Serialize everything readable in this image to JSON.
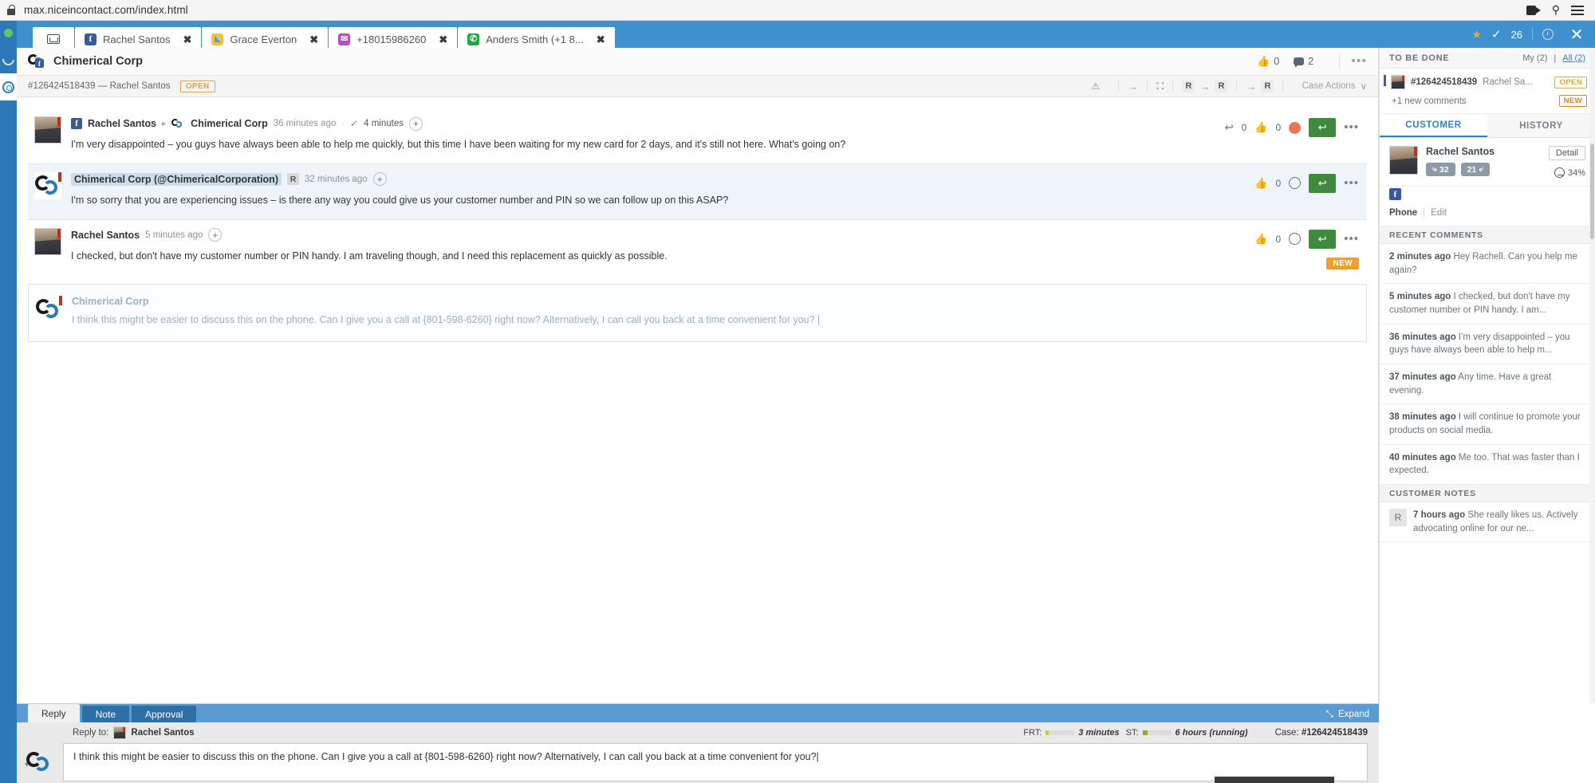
{
  "browser": {
    "url": "max.niceincontact.com/index.html",
    "lock_icon": "lock-icon",
    "camera_icon": "camera-icon",
    "pin_icon": "pin-icon",
    "menu_icon": "menu-icon"
  },
  "tabstrip": {
    "inbox_tab_label": "",
    "tabs": [
      {
        "label": "Rachel Santos",
        "channel": "facebook",
        "glyph": "f",
        "close": "✖"
      },
      {
        "label": "Grace Everton",
        "channel": "twitter",
        "glyph": "",
        "close": "✖"
      },
      {
        "label": "+18015986260",
        "channel": "sms",
        "glyph": "✉",
        "close": "✖"
      },
      {
        "label": "Anders Smith (+1 8...",
        "channel": "whatsapp",
        "glyph": "✆",
        "close": "✖"
      }
    ],
    "star_icon": "★",
    "check_icon": "✓",
    "count": "26",
    "clock_icon": "clock-icon",
    "close_icon": "✕"
  },
  "rail": {
    "status_dot": "online-status-dot",
    "link_icon": "link-icon",
    "gear_icon": "gear-icon"
  },
  "case": {
    "brand_title": "Chimerical Corp",
    "likes": "0",
    "comments": "2",
    "more_icon": "•••",
    "case_id_line": "#126424518439 — Rachel Santos",
    "status": "OPEN",
    "warn_icon": "⚠",
    "arrow_icon": "→",
    "group_icon": "⛚",
    "r_label": "R",
    "case_actions_label": "Case Actions",
    "chevron_down": "∨"
  },
  "messages": [
    {
      "type": "customer",
      "sender": "Rachel Santos",
      "channel_glyph": "f",
      "destination": "Chimerical Corp",
      "time": "36 minutes ago",
      "resolve_tick": "✓",
      "resolve_time": "4 minutes",
      "plus": "+",
      "text": "I'm very disappointed – you guys have always been able to help me quickly, but this time I have been waiting for my new card for 2 days, and it's still not here. What's going on?",
      "reply_count": "0",
      "like_count": "0",
      "reply_icon": "↩",
      "thumb_icon": "👍",
      "smile_icon": "smile-icon",
      "reply_button_icon": "↩",
      "more_icon": "•••"
    },
    {
      "type": "agent",
      "sender": "Chimerical Corp (@ChimericalCorporation)",
      "rtag": "R",
      "time": "32 minutes ago",
      "plus": "+",
      "text": "I'm so sorry that you are experiencing issues – is there any way you could give  us your customer number and PIN so we can follow up on this ASAP?",
      "like_count": "0",
      "thumb_icon": "👍",
      "smile_icon": "smile-icon",
      "reply_button_icon": "↩",
      "more_icon": "•••"
    },
    {
      "type": "customer",
      "sender": "Rachel Santos",
      "time": "5 minutes ago",
      "plus": "+",
      "text": "I checked, but don't have my customer number or PIN handy. I am traveling though, and I need this replacement as quickly as possible.",
      "like_count": "0",
      "thumb_icon": "👍",
      "smile_icon": "smile-icon",
      "reply_button_icon": "↩",
      "more_icon": "•••",
      "new_badge": "NEW"
    }
  ],
  "draft": {
    "sender": "Chimerical Corp",
    "text": "I think this might be easier to discuss this on the phone. Can I give you a call at {801-598-6260} right now? Alternatively, I can call you back at a time convenient for you? |"
  },
  "right_panel": {
    "to_be_done_title": "TO BE DONE",
    "my_label": "My (2)",
    "all_label": "All (2)",
    "separator": "|",
    "item": {
      "id": "#126424518439",
      "name": "Rachel Sa...",
      "status": "OPEN",
      "sub": "+1 new comments",
      "sub_badge": "NEW"
    },
    "tabs": [
      {
        "label": "CUSTOMER",
        "active": true
      },
      {
        "label": "HISTORY",
        "active": false
      }
    ],
    "customer": {
      "name": "Rachel Santos",
      "detail_button": "Detail",
      "followers": "32",
      "following": "21",
      "sentiment": "34%",
      "facebook_glyph": "f",
      "phone_label": "Phone",
      "phone_value": "",
      "edit_label": "Edit",
      "divider": "|"
    },
    "recent_comments_title": "RECENT COMMENTS",
    "recent_comments": [
      {
        "time": "2 minutes ago",
        "text": "Hey Rachell. Can you help me again?"
      },
      {
        "time": "5 minutes ago",
        "text": "I checked, but don't have my customer number or PIN handy. I am..."
      },
      {
        "time": "36 minutes ago",
        "text": "I'm very disappointed – you guys have always been able to help m..."
      },
      {
        "time": "37 minutes ago",
        "text": "Any time. Have a great evening."
      },
      {
        "time": "38 minutes ago",
        "text": "I will continue to promote your products on social media."
      },
      {
        "time": "40 minutes ago",
        "text": "Me too. That was faster than I expected."
      }
    ],
    "customer_notes_title": "CUSTOMER NOTES",
    "customer_notes": [
      {
        "avatar": "R",
        "time": "7 hours ago",
        "text": "She really likes us. Actively advocating online for our ne..."
      }
    ]
  },
  "composer": {
    "tabs": [
      {
        "label": "Reply",
        "active": true
      },
      {
        "label": "Note",
        "active": false
      },
      {
        "label": "Approval",
        "active": false
      }
    ],
    "expand_label": "Expand",
    "expand_icon": "⤡",
    "reply_to_label": "Reply to:",
    "reply_to_name": "Rachel Santos",
    "frt_label": "FRT:",
    "frt_value": "3 minutes",
    "st_label": "ST:",
    "st_value": "6 hours (running)",
    "case_label": "Case:",
    "case_number": "#126424518439",
    "input_value": "I think this might be easier to discuss this on the phone. Can I give you a call at {801-598-6260} right now? Alternatively, I can call you back at a time convenient for you?|"
  },
  "colors": {
    "brand_blue": "#2c78b8",
    "tabstrip_blue": "#3f90cf",
    "open_orange": "#e8a33d",
    "new_orange": "#f0a02a",
    "reply_green": "#3f8a3f",
    "agent_bg": "#eef4fa"
  }
}
